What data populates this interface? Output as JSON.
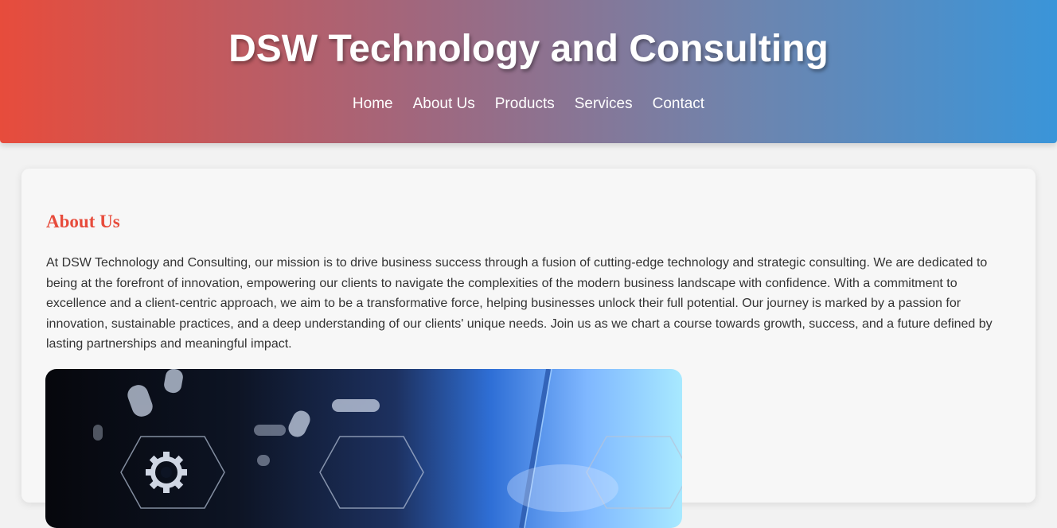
{
  "header": {
    "site_title": "DSW Technology and Consulting",
    "nav": [
      {
        "label": "Home"
      },
      {
        "label": "About Us"
      },
      {
        "label": "Products"
      },
      {
        "label": "Services"
      },
      {
        "label": "Contact"
      }
    ]
  },
  "about": {
    "title": "About Us",
    "text": "At DSW Technology and Consulting, our mission is to drive business success through a fusion of cutting-edge technology and strategic consulting. We are dedicated to being at the forefront of innovation, empowering our clients to navigate the complexities of the modern business landscape with confidence. With a commitment to excellence and a client-centric approach, we aim to be a transformative force, helping businesses unlock their full potential. Our journey is marked by a passion for innovation, sustainable practices, and a deep understanding of our clients' unique needs. Join us as we chart a course towards growth, success, and a future defined by lasting partnerships and meaningful impact."
  },
  "colors": {
    "header_gradient_start": "#e74c3c",
    "header_gradient_end": "#3a95d9",
    "section_title": "#e74c3c",
    "body_text": "#333333"
  },
  "icons": {
    "hero_gear": "gear-icon"
  }
}
